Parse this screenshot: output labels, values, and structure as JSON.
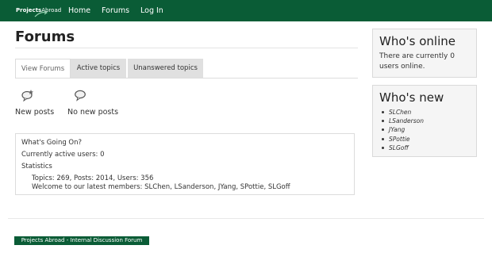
{
  "navbar": {
    "logo": {
      "part1": "Projects",
      "part2": "Abroad"
    },
    "links": [
      {
        "label": "Home"
      },
      {
        "label": "Forums"
      },
      {
        "label": "Log In"
      }
    ]
  },
  "main": {
    "title": "Forums",
    "tabs": [
      {
        "label": "View Forums",
        "active": true
      },
      {
        "label": "Active topics",
        "active": false
      },
      {
        "label": "Unanswered topics",
        "active": false
      }
    ],
    "legend": [
      {
        "label": "New posts",
        "icon": "new-posts-icon"
      },
      {
        "label": "No new posts",
        "icon": "no-new-posts-icon"
      }
    ],
    "stats": {
      "heading": "What's Going On?",
      "active_users": "Currently active users: 0",
      "statistics_heading": "Statistics",
      "totals": "Topics: 269, Posts: 2014, Users: 356",
      "latest_members": "Welcome to our latest members: SLChen, LSanderson, JYang, SPottie, SLGoff"
    }
  },
  "sidebar": {
    "online": {
      "title": "Who's online",
      "text": "There are currently 0 users online."
    },
    "new_users": {
      "title": "Who's new",
      "items": [
        "SLChen",
        "LSanderson",
        "JYang",
        "SPottie",
        "SLGoff"
      ]
    }
  },
  "footer": {
    "badge": "Projects Abroad - Internal Discussion Forum"
  },
  "colors": {
    "brand_green": "#0a5c36",
    "tab_inactive": "#e0e0e0",
    "sidebar_bg": "#f5f5f5"
  }
}
